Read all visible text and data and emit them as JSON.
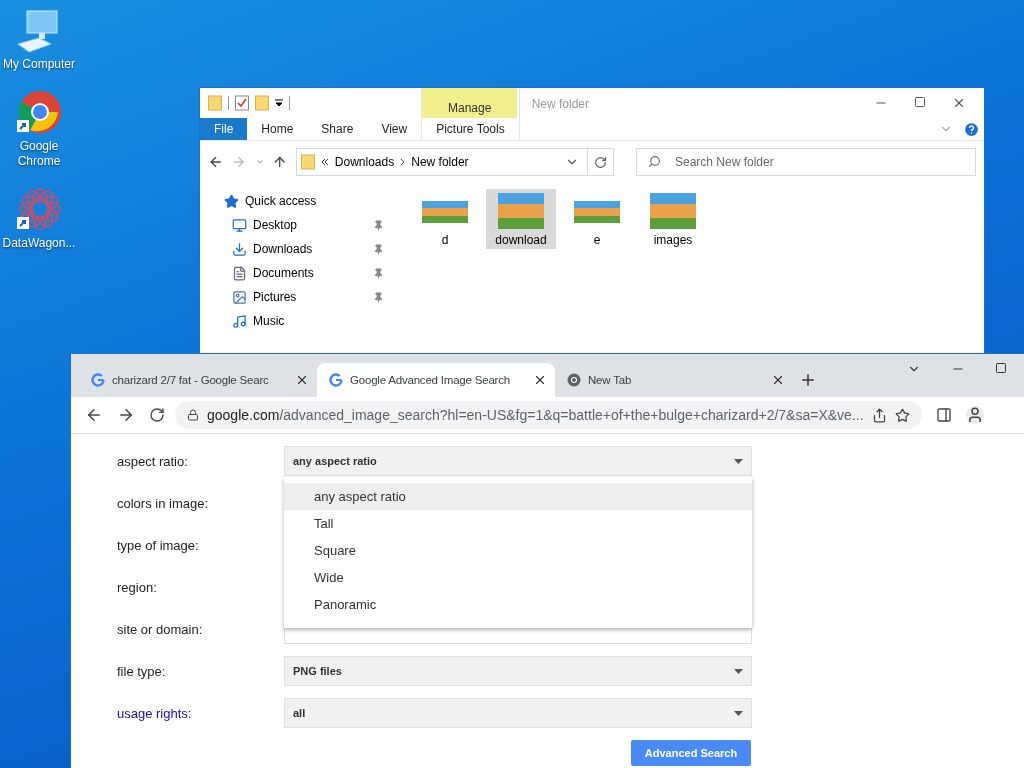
{
  "desktop_icons": [
    {
      "label": "My Computer",
      "kind": "computer"
    },
    {
      "label": "Google Chrome",
      "kind": "chrome"
    },
    {
      "label": "DataWagon...",
      "kind": "mandala"
    }
  ],
  "explorer": {
    "title": "New folder",
    "context_header": "Manage",
    "quick_access_toolbar": [
      {
        "kind": "folder"
      },
      {
        "kind": "properties"
      },
      {
        "kind": "folder"
      }
    ],
    "ribbon_tabs": [
      {
        "label": "File",
        "kind": "file"
      },
      {
        "label": "Home",
        "kind": "plain"
      },
      {
        "label": "Share",
        "kind": "plain"
      },
      {
        "label": "View",
        "kind": "plain"
      },
      {
        "label": "Picture Tools",
        "kind": "context"
      }
    ],
    "breadcrumb": [
      "Downloads",
      "New folder"
    ],
    "search": {
      "placeholder": "Search New folder"
    },
    "nav": [
      {
        "label": "Quick access",
        "kind": "star",
        "pinned": false
      },
      {
        "label": "Desktop",
        "kind": "desktop",
        "pinned": true
      },
      {
        "label": "Downloads",
        "kind": "download",
        "pinned": true
      },
      {
        "label": "Documents",
        "kind": "document",
        "pinned": true
      },
      {
        "label": "Pictures",
        "kind": "pictures",
        "pinned": true
      },
      {
        "label": "Music",
        "kind": "music",
        "pinned": false
      }
    ],
    "files": [
      {
        "name": "d",
        "kind": "wide",
        "selected": false
      },
      {
        "name": "download",
        "kind": "square",
        "selected": true
      },
      {
        "name": "e",
        "kind": "wide",
        "selected": false
      },
      {
        "name": "images",
        "kind": "square",
        "selected": false
      }
    ]
  },
  "browser": {
    "tabs": [
      {
        "title": "charizard 2/7 fat - Google Searc",
        "kind": "google",
        "selected": false
      },
      {
        "title": "Google Advanced Image Search",
        "kind": "google",
        "selected": true
      },
      {
        "title": "New Tab",
        "kind": "chrome",
        "selected": false
      }
    ],
    "url": {
      "host": "google.com",
      "path": "/advanced_image_search?hl=en-US&fg=1&q=battle+of+the+bulge+charizard+2/7&sa=X&ve..."
    },
    "form": [
      {
        "label": "aspect ratio:",
        "link": false,
        "field": {
          "kind": "select",
          "value": "any aspect ratio"
        }
      },
      {
        "label": "colors in image:",
        "link": false
      },
      {
        "label": "type of image:",
        "link": false
      },
      {
        "label": "region:",
        "link": false
      },
      {
        "label": "site or domain:",
        "link": false,
        "field": {
          "kind": "text"
        }
      },
      {
        "label": "file type:",
        "link": false,
        "field": {
          "kind": "select",
          "value": "PNG files"
        }
      },
      {
        "label": "usage rights:",
        "link": true,
        "field": {
          "kind": "select",
          "value": "all"
        }
      }
    ],
    "dropdown": [
      {
        "label": "any aspect ratio",
        "selected": true
      },
      {
        "label": "Tall",
        "selected": false
      },
      {
        "label": "Square",
        "selected": false
      },
      {
        "label": "Wide",
        "selected": false
      },
      {
        "label": "Panoramic",
        "selected": false
      }
    ],
    "submit": "Advanced Search"
  }
}
